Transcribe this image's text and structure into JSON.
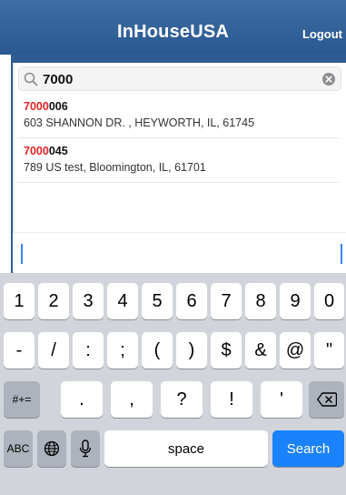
{
  "header": {
    "title": "InHouseUSA",
    "logout_label": "Logout"
  },
  "search": {
    "value": "7000"
  },
  "results": [
    {
      "id_match": "7000",
      "id_rest": "006",
      "address": "603 SHANNON DR. , HEYWORTH, IL, 61745"
    },
    {
      "id_match": "7000",
      "id_rest": "045",
      "address": "789 US test, Bloomington, IL, 61701"
    }
  ],
  "keyboard": {
    "row1": [
      "1",
      "2",
      "3",
      "4",
      "5",
      "6",
      "7",
      "8",
      "9",
      "0"
    ],
    "row2": [
      "-",
      "/",
      ":",
      ";",
      "(",
      ")",
      "$",
      "&",
      "@",
      "\""
    ],
    "row3_toggle": "#+=",
    "row3": [
      ".",
      ",",
      "?",
      "!",
      "'"
    ],
    "abc_label": "ABC",
    "space_label": "space",
    "search_label": "Search"
  },
  "colors": {
    "navbar": "#2f5d92",
    "highlight": "#e02525",
    "search_key": "#1a82fb"
  }
}
